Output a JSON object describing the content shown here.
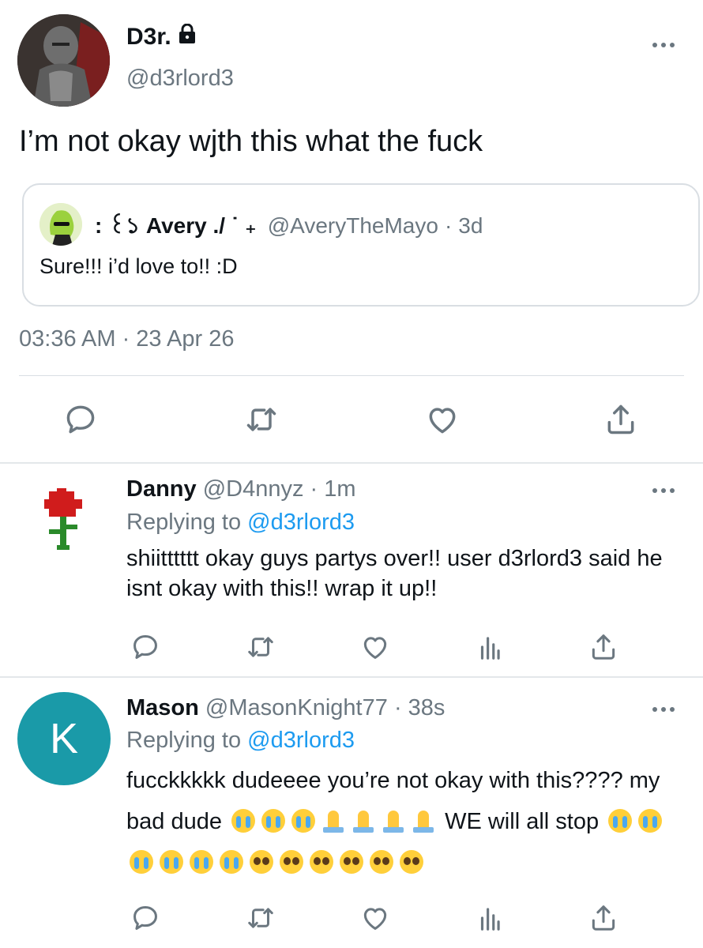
{
  "main_tweet": {
    "display_name": "D3r.",
    "handle": "@d3rlord3",
    "text": "I’m not okay wjth this what the fuck",
    "quote": {
      "display_name": ": ꒰১ Avery ./ ˙ ₊",
      "handle": "@AveryTheMayo",
      "separator": "·",
      "age": "3d",
      "text": "Sure!!! i’d love to!! :D"
    },
    "timestamp": "03:36 AM · 23 Apr 26",
    "actions": [
      "reply-icon",
      "retweet-icon",
      "like-icon",
      "share-icon"
    ]
  },
  "replies": [
    {
      "display_name": "Danny",
      "handle": "@D4nnyz",
      "separator": "·",
      "age": "1m",
      "replying_prefix": "Replying to",
      "replying_to": "@d3rlord3",
      "text": "shiitttttt okay guys partys over!! user d3rlord3 said he isnt okay with this!! wrap it up!!"
    },
    {
      "display_name": "Mason",
      "handle": "@MasonKnight77",
      "separator": "·",
      "age": "38s",
      "avatar_letter": "K",
      "avatar_color": "#1a9aa8",
      "replying_prefix": "Replying to",
      "replying_to": "@d3rlord3",
      "text_part1": "fucckkkkk dudeeee you’re not okay with this???? my bad dude",
      "text_part2": "WE will all stop",
      "emojis_part1": [
        "loudly-crying-face",
        "loudly-crying-face",
        "loudly-crying-face",
        "folded-hands",
        "folded-hands",
        "folded-hands",
        "folded-hands"
      ],
      "emojis_part2": [
        "loudly-crying-face",
        "loudly-crying-face",
        "loudly-crying-face",
        "loudly-crying-face",
        "loudly-crying-face",
        "loudly-crying-face",
        "pleading-face",
        "pleading-face",
        "pleading-face",
        "pleading-face",
        "pleading-face",
        "pleading-face"
      ]
    }
  ],
  "colors": {
    "link": "#1d9bf0",
    "muted": "#6b7780",
    "divider": "#d9dee3"
  }
}
